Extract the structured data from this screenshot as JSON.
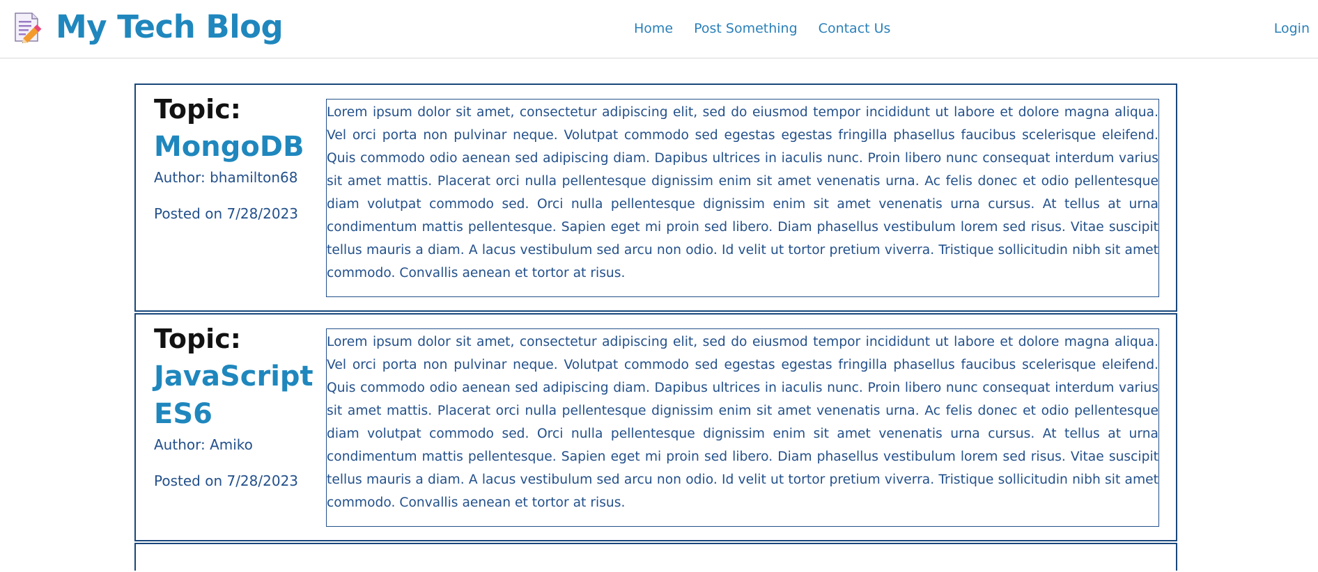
{
  "header": {
    "brand_title": "My Tech Blog",
    "nav": [
      {
        "label": "Home"
      },
      {
        "label": "Post Something"
      },
      {
        "label": "Contact Us"
      }
    ],
    "login_label": "Login"
  },
  "posts": [
    {
      "topic_label": "Topic:",
      "title": "MongoDB",
      "author": "Author: bhamilton68",
      "posted": "Posted on 7/28/2023",
      "body": "Lorem ipsum dolor sit amet, consectetur adipiscing elit, sed do eiusmod tempor incididunt ut labore et dolore magna aliqua. Vel orci porta non pulvinar neque. Volutpat commodo sed egestas egestas fringilla phasellus faucibus scelerisque eleifend. Quis commodo odio aenean sed adipiscing diam. Dapibus ultrices in iaculis nunc. Proin libero nunc consequat interdum varius sit amet mattis. Placerat orci nulla pellentesque dignissim enim sit amet venenatis urna. Ac felis donec et odio pellentesque diam volutpat commodo sed. Orci nulla pellentesque dignissim enim sit amet venenatis urna cursus. At tellus at urna condimentum mattis pellentesque. Sapien eget mi proin sed libero. Diam phasellus vestibulum lorem sed risus. Vitae suscipit tellus mauris a diam. A lacus vestibulum sed arcu non odio. Id velit ut tortor pretium viverra. Tristique sollicitudin nibh sit amet commodo. Convallis aenean et tortor at risus."
    },
    {
      "topic_label": "Topic:",
      "title": "JavaScript ES6",
      "author": "Author: Amiko",
      "posted": "Posted on 7/28/2023",
      "body": "Lorem ipsum dolor sit amet, consectetur adipiscing elit, sed do eiusmod tempor incididunt ut labore et dolore magna aliqua. Vel orci porta non pulvinar neque. Volutpat commodo sed egestas egestas fringilla phasellus faucibus scelerisque eleifend. Quis commodo odio aenean sed adipiscing diam. Dapibus ultrices in iaculis nunc. Proin libero nunc consequat interdum varius sit amet mattis. Placerat orci nulla pellentesque dignissim enim sit amet venenatis urna. Ac felis donec et odio pellentesque diam volutpat commodo sed. Orci nulla pellentesque dignissim enim sit amet venenatis urna cursus. At tellus at urna condimentum mattis pellentesque. Sapien eget mi proin sed libero. Diam phasellus vestibulum lorem sed risus. Vitae suscipit tellus mauris a diam. A lacus vestibulum sed arcu non odio. Id velit ut tortor pretium viverra. Tristique sollicitudin nibh sit amet commodo. Convallis aenean et tortor at risus."
    }
  ],
  "icons": {
    "brand_icon": "notepad-pencil-icon"
  },
  "colors": {
    "brand": "#1f87bd",
    "link": "#2a80b9",
    "border": "#18467a",
    "body_text": "#23508a",
    "heading": "#121212"
  }
}
